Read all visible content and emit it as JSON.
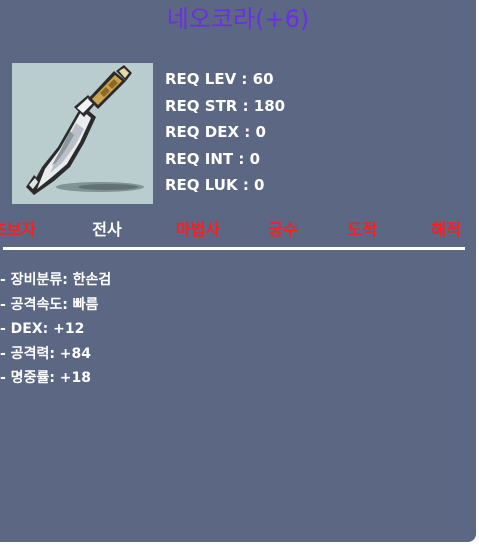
{
  "item": {
    "name": "네오코라(+6)",
    "name_color": "#6b2ee6",
    "icon": "dagger-icon"
  },
  "requirements": [
    {
      "label": "REQ LEV",
      "value": "60"
    },
    {
      "label": "REQ STR",
      "value": "180"
    },
    {
      "label": "REQ DEX",
      "value": "0"
    },
    {
      "label": "REQ INT",
      "value": "0"
    },
    {
      "label": "REQ LUK",
      "value": "0"
    }
  ],
  "requirement_lines": [
    "REQ LEV : 60",
    "REQ STR : 180",
    "REQ DEX : 0",
    "REQ INT : 0",
    "REQ LUK : 0"
  ],
  "jobs": [
    {
      "name": "초보자",
      "available": false
    },
    {
      "name": "전사",
      "available": true
    },
    {
      "name": "마법사",
      "available": false
    },
    {
      "name": "궁수",
      "available": false
    },
    {
      "name": "도적",
      "available": false
    },
    {
      "name": "해적",
      "available": false
    }
  ],
  "colors": {
    "background": "#5c6784",
    "job_available": "#ffffff",
    "job_unavailable": "#ff1c1c",
    "icon_background": "#b9cdcf"
  },
  "stats": [
    "- 장비분류: 한손검",
    "- 공격속도: 빠름",
    "- DEX: +12",
    "- 공격력: +84",
    "- 명중률: +18"
  ]
}
